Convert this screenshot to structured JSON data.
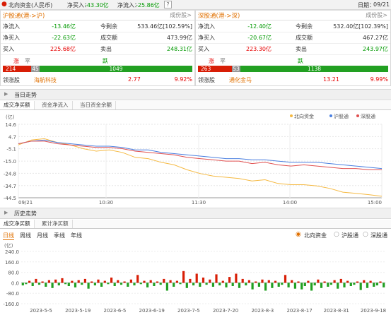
{
  "topbar": {
    "title": "北向资金(人民币)",
    "net_in_label": "净买入：",
    "net_in_value": "-43.30亿",
    "net_flow_label": "净流入：",
    "net_flow_value": "-25.86亿",
    "help": "?",
    "date_label": "日期：",
    "date_value": "09/21"
  },
  "sh": {
    "title": "沪股通(港->沪)",
    "more": "成份股>",
    "r1": {
      "l1": "净流入",
      "v1": "-13.46亿",
      "l2": "今剩余",
      "v2": "533.46亿[102.59%]"
    },
    "r2": {
      "l1": "净买入",
      "v1": "-22.63亿",
      "l2": "成交额",
      "v2": "473.99亿"
    },
    "r3": {
      "l1": "买入",
      "v1": "225.68亿",
      "l2": "卖出",
      "v2": "248.31亿"
    },
    "up_label": "涨",
    "flat_label": "平",
    "down_label": "跌",
    "up": "214",
    "flat": "45",
    "down": "1049",
    "lead_label": "领涨股",
    "lead_name": "海航科技",
    "lead_price": "2.77",
    "lead_pct": "9.92%"
  },
  "sz": {
    "title": "深股通(港->深)",
    "more": "成份股>",
    "r1": {
      "l1": "净流入",
      "v1": "-12.40亿",
      "l2": "今剩余",
      "v2": "532.40亿[102.39%]"
    },
    "r2": {
      "l1": "净买入",
      "v1": "-20.67亿",
      "l2": "成交额",
      "v2": "467.27亿"
    },
    "r3": {
      "l1": "买入",
      "v1": "223.30亿",
      "l2": "卖出",
      "v2": "243.97亿"
    },
    "up_label": "涨",
    "flat_label": "平",
    "down_label": "跌",
    "up": "263",
    "flat": "53",
    "down": "1138",
    "lead_label": "领涨股",
    "lead_name": "通化金马",
    "lead_price": "13.21",
    "lead_pct": "9.99%"
  },
  "colors": {
    "north": "#f5b942",
    "sh": "#4a7fe0",
    "sz": "#e05050",
    "up": "#d81e06",
    "down": "#22a022",
    "flat": "#888888"
  },
  "intraday": {
    "section_title": "当日走势",
    "tabs": [
      "成交净买额",
      "资金净流入",
      "当日资金余额"
    ],
    "unit": "(亿)"
  },
  "history": {
    "section_title": "历史走势",
    "tabs": [
      "成交净买额",
      "累计净买额"
    ],
    "periods": [
      "日线",
      "周线",
      "月线",
      "季线",
      "年线"
    ],
    "radios": [
      "北向资金",
      "沪股通",
      "深股通"
    ],
    "unit": "(亿)"
  },
  "chart_data": [
    {
      "type": "line",
      "x_ticks": [
        "09/21",
        "10:30",
        "11:30",
        "14:00",
        "15:00"
      ],
      "y_ticks": [
        14.6,
        4.7,
        -5.1,
        -15.0,
        -24.8,
        -34.7,
        -44.5
      ],
      "ylim": [
        -44.5,
        14.6
      ],
      "legend": [
        "北向资金",
        "沪股通",
        "深股通"
      ],
      "legend_position": "top-right",
      "series": [
        {
          "name": "北向资金",
          "values": [
            -2,
            2,
            3,
            0,
            -2,
            -5,
            -7,
            -6,
            -8,
            -12,
            -13,
            -16,
            -18,
            -22,
            -25,
            -27,
            -28,
            -29,
            -31,
            -30,
            -33,
            -34,
            -34,
            -35,
            -37,
            -40,
            -41,
            -42,
            -43.3
          ]
        },
        {
          "name": "沪股通",
          "values": [
            -1,
            1,
            2,
            0,
            -1,
            -2,
            -3,
            -3,
            -4,
            -6,
            -6,
            -8,
            -9,
            -10,
            -11,
            -12,
            -13,
            -13,
            -14,
            -14,
            -15,
            -16,
            -16,
            -16,
            -17,
            -18,
            -19,
            -20,
            -21
          ]
        },
        {
          "name": "深股通",
          "values": [
            -1,
            1,
            1,
            -1,
            -2,
            -3,
            -4,
            -4,
            -5,
            -7,
            -8,
            -9,
            -10,
            -12,
            -13,
            -14,
            -15,
            -15,
            -17,
            -16,
            -18,
            -19,
            -18,
            -19,
            -20,
            -21,
            -21,
            -22,
            -22
          ]
        }
      ]
    },
    {
      "type": "bar",
      "x_ticks": [
        "2023-5-5",
        "2023-5-19",
        "2023-6-5",
        "2023-6-19",
        "2023-7-5",
        "2023-7-20",
        "2023-8-3",
        "2023-8-17",
        "2023-8-31",
        "2023-9-18"
      ],
      "y_ticks": [
        240.0,
        160.0,
        80.0,
        0.0,
        -80.0,
        -160.0
      ],
      "ylim": [
        -160,
        240
      ],
      "values": [
        -20,
        -10,
        15,
        -25,
        30,
        -15,
        10,
        -30,
        20,
        -40,
        25,
        -20,
        35,
        -10,
        -25,
        15,
        -35,
        20,
        -15,
        30,
        -45,
        10,
        -20,
        25,
        -30,
        15,
        -10,
        40,
        -25,
        20,
        -15,
        10,
        -30,
        25,
        -20,
        60,
        -10,
        15,
        -35,
        20,
        -25,
        10,
        -15,
        30,
        -60,
        20,
        -30,
        15,
        -10,
        90,
        -40,
        30,
        -20,
        70,
        -30,
        40,
        -15,
        25,
        -30,
        65,
        -20,
        15,
        -35,
        45,
        -25,
        70,
        -40,
        30,
        -20,
        20,
        -50,
        10,
        -30,
        25,
        -60,
        20,
        -40,
        15,
        -30,
        -15,
        60,
        -35,
        20,
        -45,
        10,
        -50,
        -25,
        15,
        -60,
        -20,
        25,
        -40,
        10,
        -30,
        -15,
        20,
        -45,
        30,
        -35,
        15,
        -25,
        -15,
        10,
        -55,
        20,
        -40,
        15,
        -30,
        -20,
        10,
        -35
      ]
    }
  ]
}
